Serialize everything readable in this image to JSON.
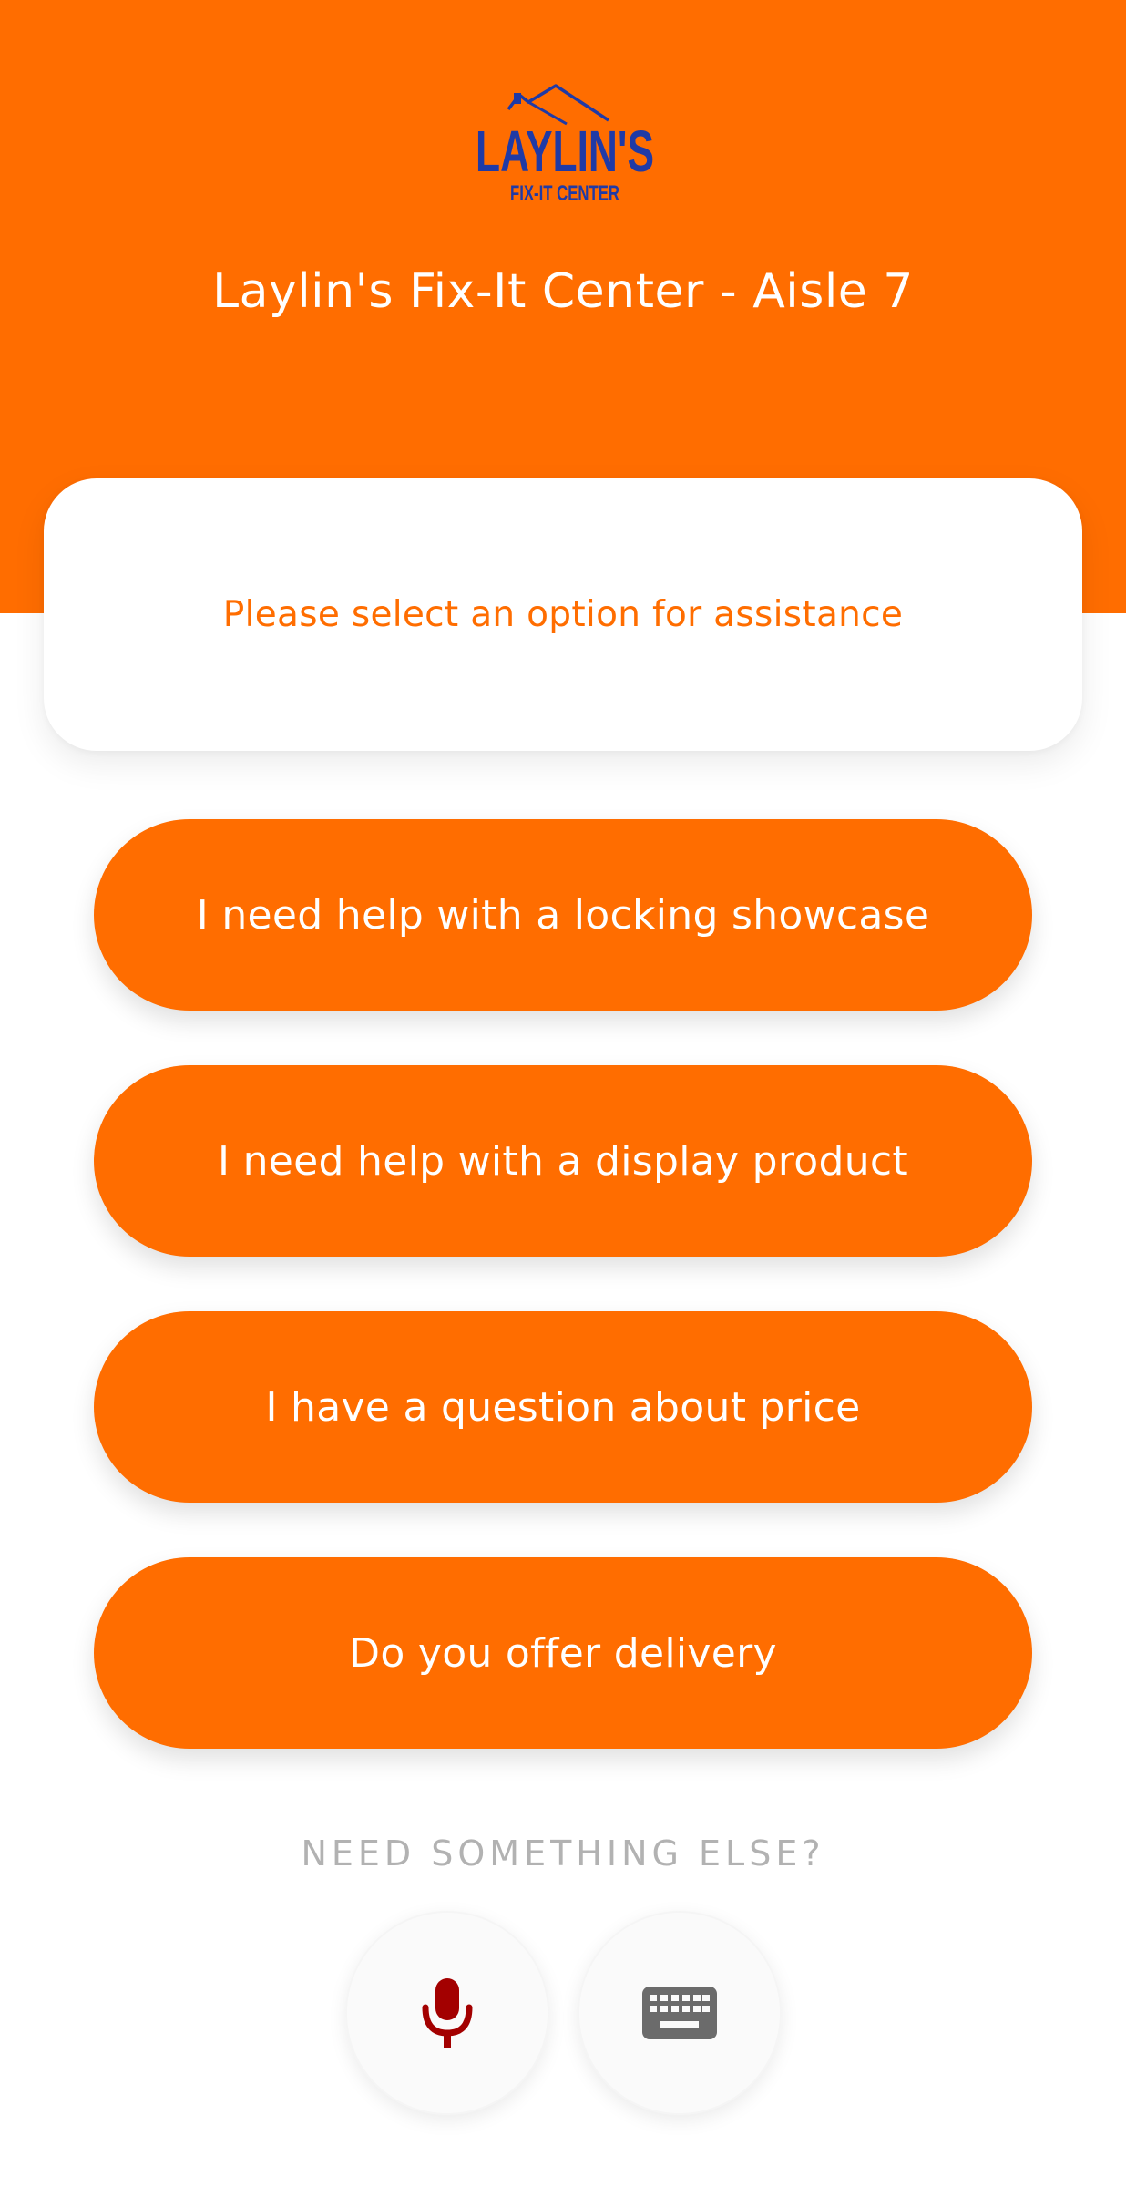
{
  "header": {
    "logo_name": "LAYLIN'S",
    "logo_subtitle": "FIX-IT CENTER",
    "title": "Laylin's Fix-It Center - Aisle 7"
  },
  "prompt": {
    "text": "Please select an option for assistance"
  },
  "options": [
    {
      "label": "I need help with a locking showcase"
    },
    {
      "label": "I need help with a display product"
    },
    {
      "label": "I have a question about price"
    },
    {
      "label": "Do you offer delivery"
    }
  ],
  "footer": {
    "need_else_label": "NEED SOMETHING ELSE?",
    "mic_icon": "microphone-icon",
    "keyboard_icon": "keyboard-icon"
  },
  "colors": {
    "brand_orange": "#ff6d00",
    "logo_blue": "#1f3aa6",
    "mic_red": "#a30000",
    "keyboard_gray": "#6b6b6b",
    "muted_text": "#b2b2b2"
  }
}
